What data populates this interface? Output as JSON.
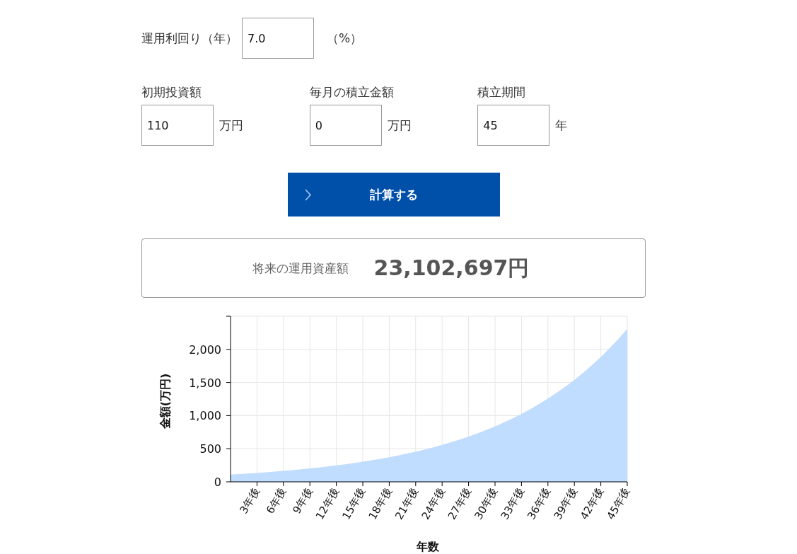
{
  "rate": {
    "label": "運用利回り（年）",
    "value": "7.0",
    "unit": "（%）"
  },
  "fields": [
    {
      "label": "初期投資額",
      "value": "110",
      "unit": "万円"
    },
    {
      "label": "毎月の積立金額",
      "value": "0",
      "unit": "万円"
    },
    {
      "label": "積立期間",
      "value": "45",
      "unit": "年"
    }
  ],
  "button": {
    "label": "計算する"
  },
  "result": {
    "label": "将来の運用資産額",
    "value": "23,102,697円"
  },
  "chart": {
    "chart_data": {
      "type": "area",
      "xlabel": "年数",
      "ylabel": "金額(万円)",
      "x": [
        0,
        1,
        2,
        3,
        4,
        5,
        6,
        7,
        8,
        9,
        10,
        11,
        12,
        13,
        14,
        15,
        16,
        17,
        18,
        19,
        20,
        21,
        22,
        23,
        24,
        25,
        26,
        27,
        28,
        29,
        30,
        31,
        32,
        33,
        34,
        35,
        36,
        37,
        38,
        39,
        40,
        41,
        42,
        43,
        44,
        45
      ],
      "series": [
        {
          "color": "#c0dcff",
          "values": [
            110,
            118,
            126,
            135,
            144,
            154,
            165,
            177,
            189,
            202,
            216,
            232,
            248,
            265,
            284,
            303,
            325,
            347,
            372,
            398,
            426,
            455,
            487,
            521,
            558,
            597,
            639,
            684,
            731,
            783,
            837,
            896,
            959,
            1026,
            1098,
            1174,
            1257,
            1345,
            1439,
            1539,
            1647,
            1762,
            1886,
            2018,
            2159,
            2310
          ]
        }
      ],
      "grid": true,
      "xlim": [
        0,
        45
      ],
      "ylim": [
        0,
        2500
      ],
      "xticks": [
        {
          "value": 3,
          "label": "3年後"
        },
        {
          "value": 6,
          "label": "6年後"
        },
        {
          "value": 9,
          "label": "9年後"
        },
        {
          "value": 12,
          "label": "12年後"
        },
        {
          "value": 15,
          "label": "15年後"
        },
        {
          "value": 18,
          "label": "18年後"
        },
        {
          "value": 21,
          "label": "21年後"
        },
        {
          "value": 24,
          "label": "24年後"
        },
        {
          "value": 27,
          "label": "27年後"
        },
        {
          "value": 30,
          "label": "30年後"
        },
        {
          "value": 33,
          "label": "33年後"
        },
        {
          "value": 36,
          "label": "36年後"
        },
        {
          "value": 39,
          "label": "39年後"
        },
        {
          "value": 42,
          "label": "42年後"
        },
        {
          "value": 45,
          "label": "45年後"
        }
      ],
      "yticks": [
        {
          "value": 0,
          "label": "0"
        },
        {
          "value": 500,
          "label": "500"
        },
        {
          "value": 1000,
          "label": "1,000"
        },
        {
          "value": 1500,
          "label": "1,500"
        },
        {
          "value": 2000,
          "label": "2,000"
        }
      ]
    }
  }
}
